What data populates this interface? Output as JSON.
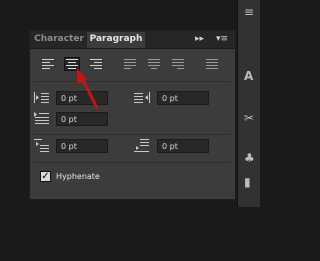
{
  "panel": {
    "tabs": [
      {
        "label": "Character",
        "active": false
      },
      {
        "label": "Paragraph",
        "active": true
      }
    ],
    "menu_icons": [
      "collapse-icon",
      "panel-menu-icon"
    ],
    "alignment_buttons": [
      {
        "name": "align-left",
        "selected": false
      },
      {
        "name": "align-center",
        "selected": true
      },
      {
        "name": "align-right",
        "selected": false
      },
      {
        "name": "justify-last-left",
        "selected": false
      },
      {
        "name": "justify-last-center",
        "selected": false
      },
      {
        "name": "justify-last-right",
        "selected": false
      },
      {
        "name": "justify-all",
        "selected": false
      }
    ],
    "fields": {
      "indent_left": "0 pt",
      "indent_right": "0 pt",
      "indent_first_line": "0 pt",
      "space_before": "0 pt",
      "space_after": "0 pt"
    },
    "hyphenate": {
      "label": "Hyphenate",
      "checked": true
    }
  },
  "annotation": {
    "color": "#c0151a"
  },
  "right_toolbar": {
    "icons": [
      "ruler-icon",
      "character-a-icon",
      "scissors-icon",
      "brush-icon",
      "stamp-icon"
    ]
  }
}
